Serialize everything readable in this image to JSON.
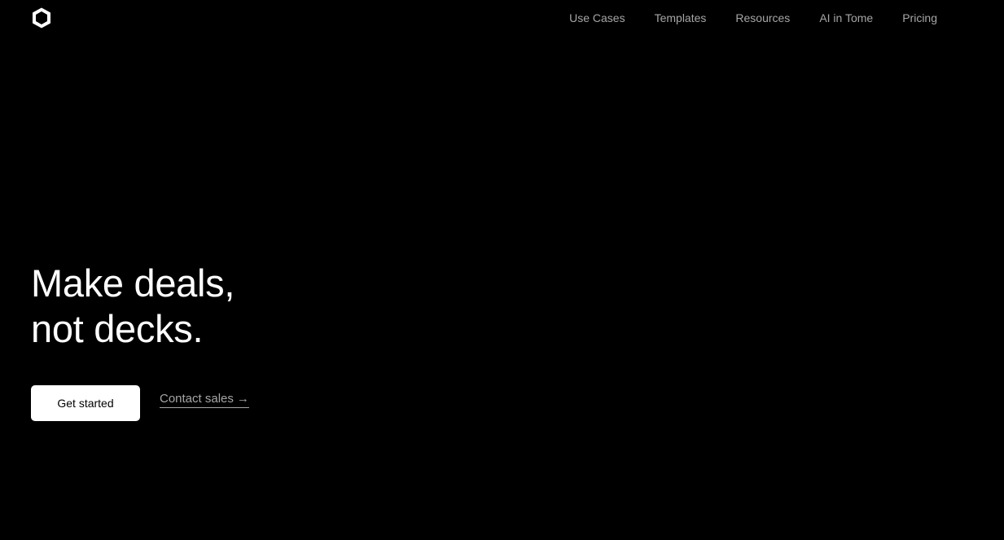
{
  "brand": {
    "logo_icon": "hexagon-logo-icon"
  },
  "nav": {
    "items": [
      {
        "label": "Use Cases"
      },
      {
        "label": "Templates"
      },
      {
        "label": "Resources"
      },
      {
        "label": "AI in Tome"
      },
      {
        "label": "Pricing"
      }
    ]
  },
  "hero": {
    "headline_line1": "Make deals,",
    "headline_line2": "not decks."
  },
  "cta": {
    "primary_label": "Get started",
    "secondary_label": "Contact sales",
    "secondary_icon": "→"
  },
  "colors": {
    "background": "#000000",
    "text": "#ffffff",
    "muted": "#a6a6a6"
  }
}
